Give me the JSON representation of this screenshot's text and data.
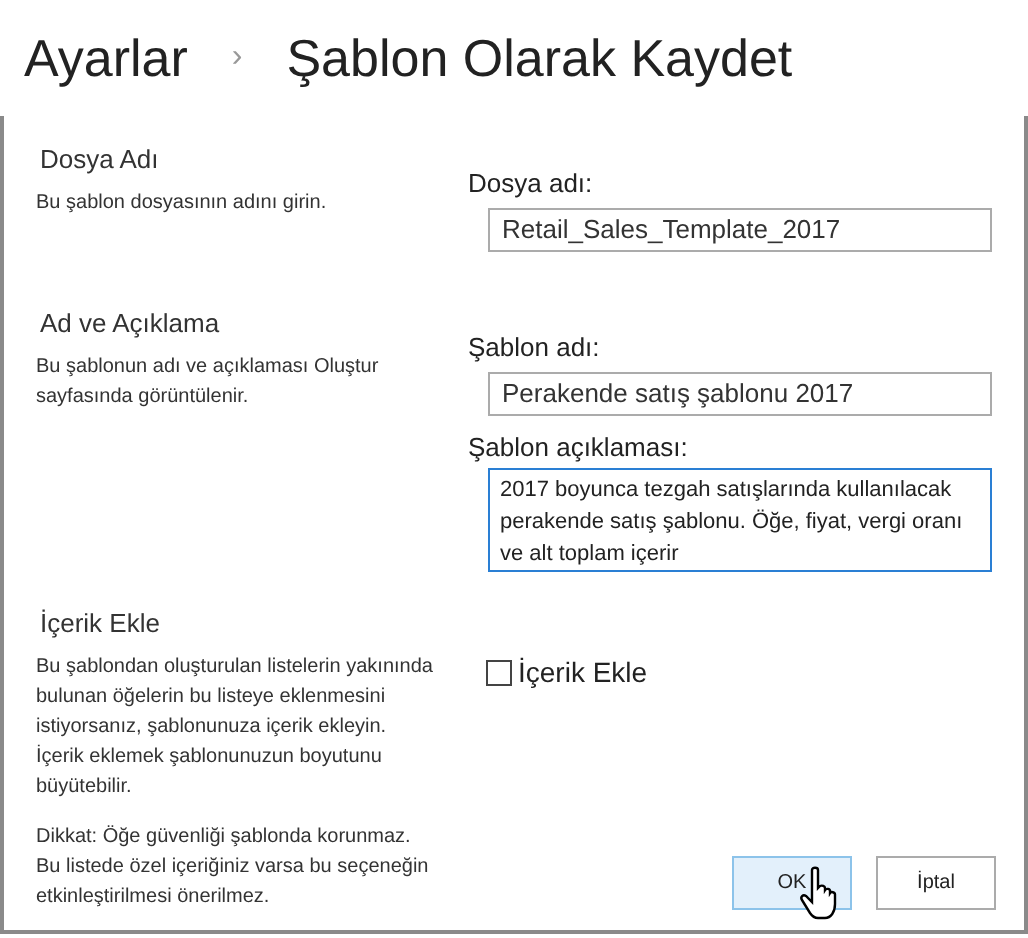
{
  "breadcrumb": {
    "parent": "Ayarlar",
    "separator": "›",
    "current": "Şablon Olarak Kaydet"
  },
  "sections": [
    {
      "kind": "text",
      "title": "Dosya Adı",
      "description": [
        "Bu şablon dosyasının adını girin."
      ],
      "fields": [
        {
          "kind": "input",
          "label": "Dosya adı:",
          "value": "Retail_Sales_Template_2017"
        }
      ]
    },
    {
      "kind": "text",
      "title": "Ad ve Açıklama",
      "description": [
        "Bu şablonun adı ve açıklaması Oluştur sayfasında görüntülenir."
      ],
      "fields": [
        {
          "kind": "input",
          "label": "Şablon adı:",
          "value": "Perakende satış şablonu 2017"
        },
        {
          "kind": "textarea",
          "label": "Şablon açıklaması:",
          "value": "2017 boyunca tezgah satışlarında kullanılacak perakende satış şablonu. Öğe, fiyat, vergi oranı ve alt toplam içerir"
        }
      ]
    },
    {
      "kind": "checkbox",
      "title": "İçerik Ekle",
      "description": [
        "Bu şablondan oluşturulan listelerin yakınında bulunan öğelerin bu listeye eklenmesini istiyorsanız, şablonunuza içerik ekleyin. İçerik eklemek şablonunuzun boyutunu büyütebilir.",
        "Dikkat: Öğe güvenliği şablonda korunmaz. Bu listede özel içeriğiniz varsa bu seçeneğin etkinleştirilmesi önerilmez."
      ],
      "checkbox": {
        "label": "İçerik Ekle",
        "checked": false
      }
    }
  ],
  "buttons": [
    {
      "label": "OK",
      "hovered": true
    },
    {
      "label": "İptal",
      "hovered": false
    }
  ]
}
